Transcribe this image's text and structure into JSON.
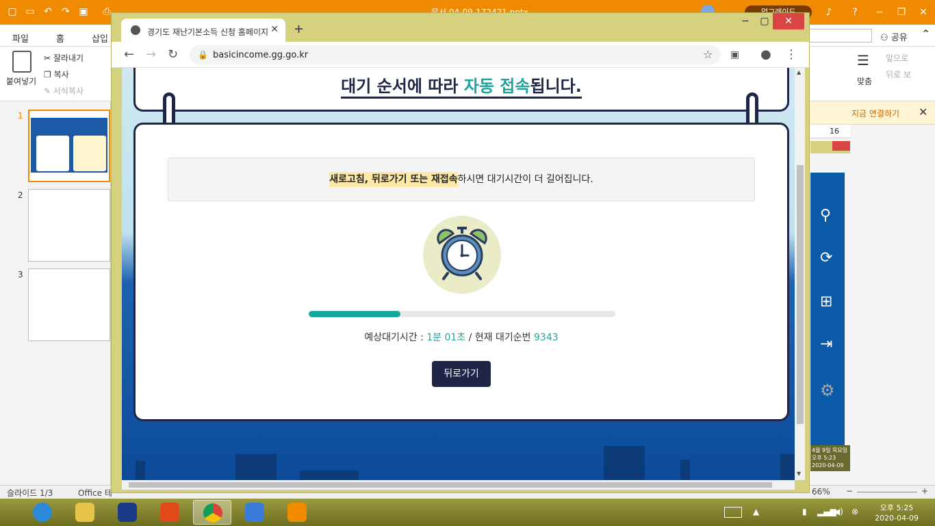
{
  "ppt": {
    "doc_title": "문서 04-09-172421.pptx",
    "upgrade": "업그레이드",
    "tabs": [
      "파일",
      "홈",
      "삽입"
    ],
    "clipboard": {
      "paste": "붙여넣기",
      "cut": "잘라내기",
      "copy": "복사",
      "format_copy": "서식복사"
    },
    "ribbon_right": {
      "fit": "맞춤",
      "forward": "앞으로",
      "backward": "뒤로 보"
    },
    "share": "공유",
    "connect": "지금 연결하기",
    "ruler_num": "16",
    "slides": [
      "1",
      "2",
      "3"
    ],
    "status_slide": "슬라이드 1/3",
    "status_theme": "Office 테",
    "zoom": "66%",
    "side_date": "4월 9일 목요일",
    "side_time": "오후 5:23",
    "side_date2": "2020-04-09"
  },
  "chrome": {
    "tab_title": "경기도 재난기본소득 신청 홈페이지",
    "url": "basicincome.gg.go.kr"
  },
  "page": {
    "heading_p1": "대기 순서에 따라 ",
    "heading_p2": "자동 접속",
    "heading_p3": "됩니다.",
    "warn_strong": "새로고침, 뒤로가기 또는 재접속",
    "warn_rest": "하시면 대기시간이 더 길어집니다.",
    "progress": 0.3,
    "wait_label": "예상대기시간 : ",
    "wait_time": "1분 01초",
    "queue_label": " / 현재 대기순번 ",
    "queue_num": "9343",
    "back_btn": "뒤로가기"
  },
  "taskbar": {
    "time": "오후 5:25",
    "date": "2020-04-09"
  },
  "colors": {
    "teal": "#1fa39a",
    "navy": "#1f2547",
    "ppt_orange": "#f08a00"
  }
}
